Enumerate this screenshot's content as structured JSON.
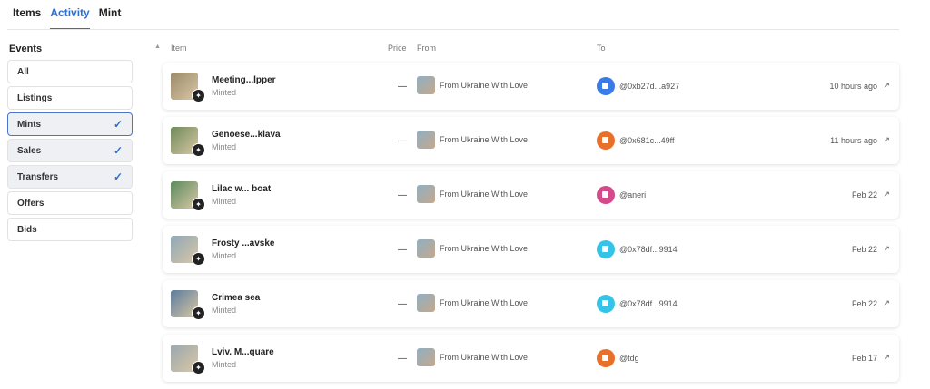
{
  "tabs": [
    {
      "label": "Items",
      "active": false
    },
    {
      "label": "Activity",
      "active": true
    },
    {
      "label": "Mint",
      "active": false
    }
  ],
  "sidebar": {
    "title": "Events",
    "filters": [
      {
        "label": "All",
        "checked": false
      },
      {
        "label": "Listings",
        "checked": false
      },
      {
        "label": "Mints",
        "checked": true
      },
      {
        "label": "Sales",
        "checked": true
      },
      {
        "label": "Transfers",
        "checked": true
      },
      {
        "label": "Offers",
        "checked": false
      },
      {
        "label": "Bids",
        "checked": false
      }
    ]
  },
  "table": {
    "headers": {
      "item": "Item",
      "price": "Price",
      "from": "From",
      "to": "To"
    },
    "rows": [
      {
        "name": "Meeting...lpper",
        "event": "Minted",
        "price": "—",
        "from": "From Ukraine With Love",
        "to": "@0xb27d...a927",
        "to_color": "#3b7be8",
        "time": "10 hours ago",
        "thumb_color": "#9b8a6b"
      },
      {
        "name": "Genoese...klava",
        "event": "Minted",
        "price": "—",
        "from": "From Ukraine With Love",
        "to": "@0x681c...49ff",
        "to_color": "#e8702a",
        "time": "11 hours ago",
        "thumb_color": "#6f8a5a"
      },
      {
        "name": "Lilac w... boat",
        "event": "Minted",
        "price": "—",
        "from": "From Ukraine With Love",
        "to": "@aneri",
        "to_color": "#d44a8a",
        "time": "Feb 22",
        "thumb_color": "#5a8a5d"
      },
      {
        "name": "Frosty ...avske",
        "event": "Minted",
        "price": "—",
        "from": "From Ukraine With Love",
        "to": "@0x78df...9914",
        "to_color": "#35c3e8",
        "time": "Feb 22",
        "thumb_color": "#8fa7b8"
      },
      {
        "name": "Crimea sea",
        "event": "Minted",
        "price": "—",
        "from": "From Ukraine With Love",
        "to": "@0x78df...9914",
        "to_color": "#35c3e8",
        "time": "Feb 22",
        "thumb_color": "#5b7c9c"
      },
      {
        "name": "Lviv. M...quare",
        "event": "Minted",
        "price": "—",
        "from": "From Ukraine With Love",
        "to": "@tdg",
        "to_color": "#e8702a",
        "time": "Feb 17",
        "thumb_color": "#9aa7b0"
      }
    ]
  },
  "icons": {
    "check": "check-icon",
    "external": "external-link-icon",
    "sort": "sort-caret-icon",
    "badge": "mint-badge-icon"
  },
  "colors": {
    "accent": "#2b6fd4",
    "focused_border": "#4a74c9"
  }
}
